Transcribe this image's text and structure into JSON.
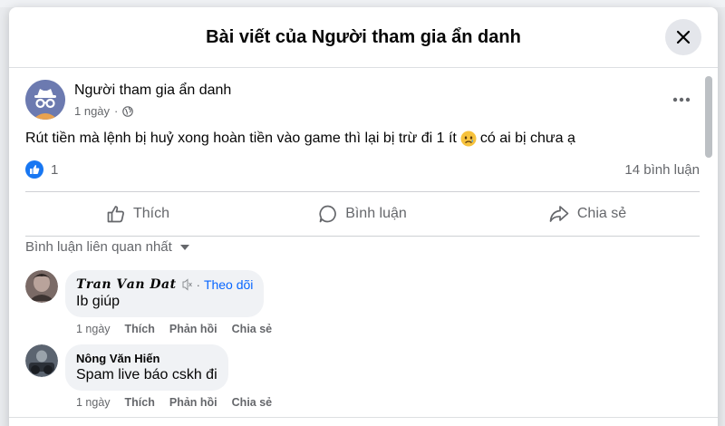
{
  "modal": {
    "title": "Bài viết của Người tham gia ẩn danh"
  },
  "post": {
    "author": "Người tham gia ẩn danh",
    "time": "1 ngày",
    "text": "Rút tiền mà lệnh bị huỷ xong hoàn tiền vào game thì lại bị trừ đi 1 ít",
    "trailing_text": "có ai bị chưa ạ",
    "like_count": "1",
    "comment_count": "14 bình luận"
  },
  "actions": {
    "like": "Thích",
    "comment": "Bình luận",
    "share": "Chia sẻ"
  },
  "comments_section": {
    "sort_label": "Bình luận liên quan nhất"
  },
  "comments": [
    {
      "author": "𝑻𝒓𝒂𝒏 𝑽𝒂𝒏 𝑫𝒂𝒕",
      "follow": "Theo dõi",
      "text": "Ib giúp",
      "time": "1 ngày",
      "like": "Thích",
      "reply": "Phản hồi",
      "share": "Chia sẻ"
    },
    {
      "author": "Nông Văn Hiến",
      "text": "Spam live báo cskh đi",
      "time": "1 ngày",
      "like": "Thích",
      "reply": "Phản hồi",
      "share": "Chia sẻ"
    }
  ],
  "colors": {
    "accent": "#0866ff",
    "secondary_text": "#65676b",
    "bubble": "#f0f2f5"
  }
}
